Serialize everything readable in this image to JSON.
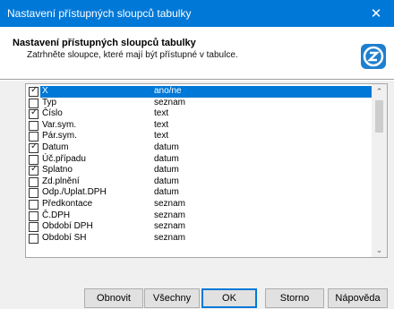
{
  "window": {
    "title": "Nastavení přístupných sloupců tabulky",
    "close_glyph": "✕"
  },
  "header": {
    "title": "Nastavení přístupných sloupců tabulky",
    "subtitle": "Zatrhněte sloupce, které mají být přístupné v tabulce.",
    "logo_icon": "app-logo-icon",
    "logo_color": "#1e7fd0"
  },
  "colors": {
    "titlebar": "#0078d7",
    "selection": "#0078d7",
    "dialog_bg": "#f0f0f0"
  },
  "columns": [
    {
      "name": "X",
      "value": "ano/ne",
      "checked": true,
      "selected": true
    },
    {
      "name": "Typ",
      "value": "seznam",
      "checked": false,
      "selected": false
    },
    {
      "name": "Číslo",
      "value": "text",
      "checked": true,
      "selected": false
    },
    {
      "name": "Var.sym.",
      "value": "text",
      "checked": false,
      "selected": false
    },
    {
      "name": "Pár.sym.",
      "value": "text",
      "checked": false,
      "selected": false
    },
    {
      "name": "Datum",
      "value": "datum",
      "checked": true,
      "selected": false
    },
    {
      "name": "Úč.případu",
      "value": "datum",
      "checked": false,
      "selected": false
    },
    {
      "name": "Splatno",
      "value": "datum",
      "checked": true,
      "selected": false
    },
    {
      "name": "Zd.plnění",
      "value": "datum",
      "checked": false,
      "selected": false
    },
    {
      "name": "Odp./Uplat.DPH",
      "value": "datum",
      "checked": false,
      "selected": false
    },
    {
      "name": "Předkontace",
      "value": "seznam",
      "checked": false,
      "selected": false
    },
    {
      "name": "Č.DPH",
      "value": "seznam",
      "checked": false,
      "selected": false
    },
    {
      "name": "Období DPH",
      "value": "seznam",
      "checked": false,
      "selected": false
    },
    {
      "name": "Období SH",
      "value": "seznam",
      "checked": false,
      "selected": false
    }
  ],
  "scrollbar": {
    "up_glyph": "⌃",
    "down_glyph": "⌄"
  },
  "buttons": {
    "refresh": "Obnovit",
    "all": "Všechny",
    "ok": "OK",
    "cancel": "Storno",
    "help": "Nápověda"
  }
}
